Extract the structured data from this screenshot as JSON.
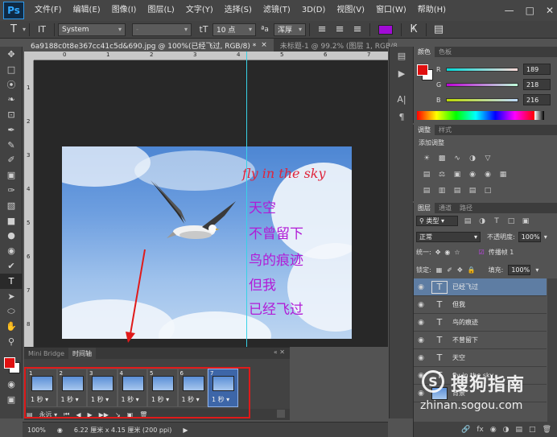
{
  "app": {
    "logo": "Ps"
  },
  "menu": [
    "文件(F)",
    "编辑(E)",
    "图像(I)",
    "图层(L)",
    "文字(Y)",
    "选择(S)",
    "滤镜(T)",
    "3D(D)",
    "视图(V)",
    "窗口(W)",
    "帮助(H)"
  ],
  "window_controls": [
    "minimize-icon",
    "maximize-icon",
    "close-icon"
  ],
  "options": {
    "font_family": "System",
    "font_style": "-",
    "font_size": "10 点",
    "aa_label": "ªa",
    "antialias": "浑厚",
    "text_color": "#a10bd6"
  },
  "doc_tabs": [
    {
      "label": "6a9188c0t8e367cc41c5d&690.jpg @ 100%(已经飞过, RGB/8) *",
      "close": "×"
    },
    {
      "label": "未标题-1 @ 99.2% (图层 1, RGB/8",
      "close": ""
    }
  ],
  "ruler": {
    "h_labels": [
      "0",
      "1",
      "2",
      "3",
      "4",
      "5",
      "6",
      "7",
      "8"
    ],
    "v_labels": [
      "1",
      "2",
      "3",
      "4",
      "5",
      "6",
      "7",
      "8"
    ]
  },
  "artwork": {
    "title": "fly in the sky",
    "lines": [
      "天空",
      "不曾留下",
      "鸟的痕迹",
      "但我",
      "已经飞过"
    ]
  },
  "timeline": {
    "tabs": [
      "Mini Bridge",
      "时间轴"
    ],
    "frames": [
      {
        "num": "1",
        "delay": "1 秒"
      },
      {
        "num": "2",
        "delay": "1 秒"
      },
      {
        "num": "3",
        "delay": "1 秒"
      },
      {
        "num": "4",
        "delay": "1 秒"
      },
      {
        "num": "5",
        "delay": "1 秒"
      },
      {
        "num": "6",
        "delay": "1 秒"
      },
      {
        "num": "7",
        "delay": "1 秒"
      }
    ],
    "loop": "永远"
  },
  "status": {
    "zoom": "100%",
    "doc_info": "6.22 厘米 x 4.15 厘米 (200 ppi)"
  },
  "color_panel": {
    "tabs": [
      "颜色",
      "色板"
    ],
    "r_label": "R",
    "g_label": "G",
    "b_label": "B",
    "r": "189",
    "g": "218",
    "b": "216",
    "fg": "#e01010",
    "bg": "#ffffff"
  },
  "adjust_panel": {
    "tabs": [
      "调整",
      "样式"
    ],
    "heading": "添加调整"
  },
  "layers_panel": {
    "tabs": [
      "图层",
      "通道",
      "路径"
    ],
    "filter_label": "类型",
    "blend_mode": "正常",
    "opacity_label": "不透明度:",
    "opacity": "100%",
    "unify_label": "统一:",
    "propagate_label": "传播帧 1",
    "lock_label": "锁定:",
    "fill_label": "填充:",
    "fill": "100%",
    "layers": [
      {
        "name": "已经飞过",
        "type": "T",
        "selected": true
      },
      {
        "name": "但我",
        "type": "T",
        "selected": false
      },
      {
        "name": "鸟的痕迹",
        "type": "T",
        "selected": false
      },
      {
        "name": "不曾留下",
        "type": "T",
        "selected": false
      },
      {
        "name": "天空",
        "type": "T",
        "selected": false
      },
      {
        "name": "fly in the sky",
        "type": "T",
        "selected": false
      },
      {
        "name": "背景",
        "type": "img",
        "selected": false
      }
    ]
  },
  "watermark": {
    "brand": "搜狗指南",
    "url": "zhinan.sogou.com"
  }
}
